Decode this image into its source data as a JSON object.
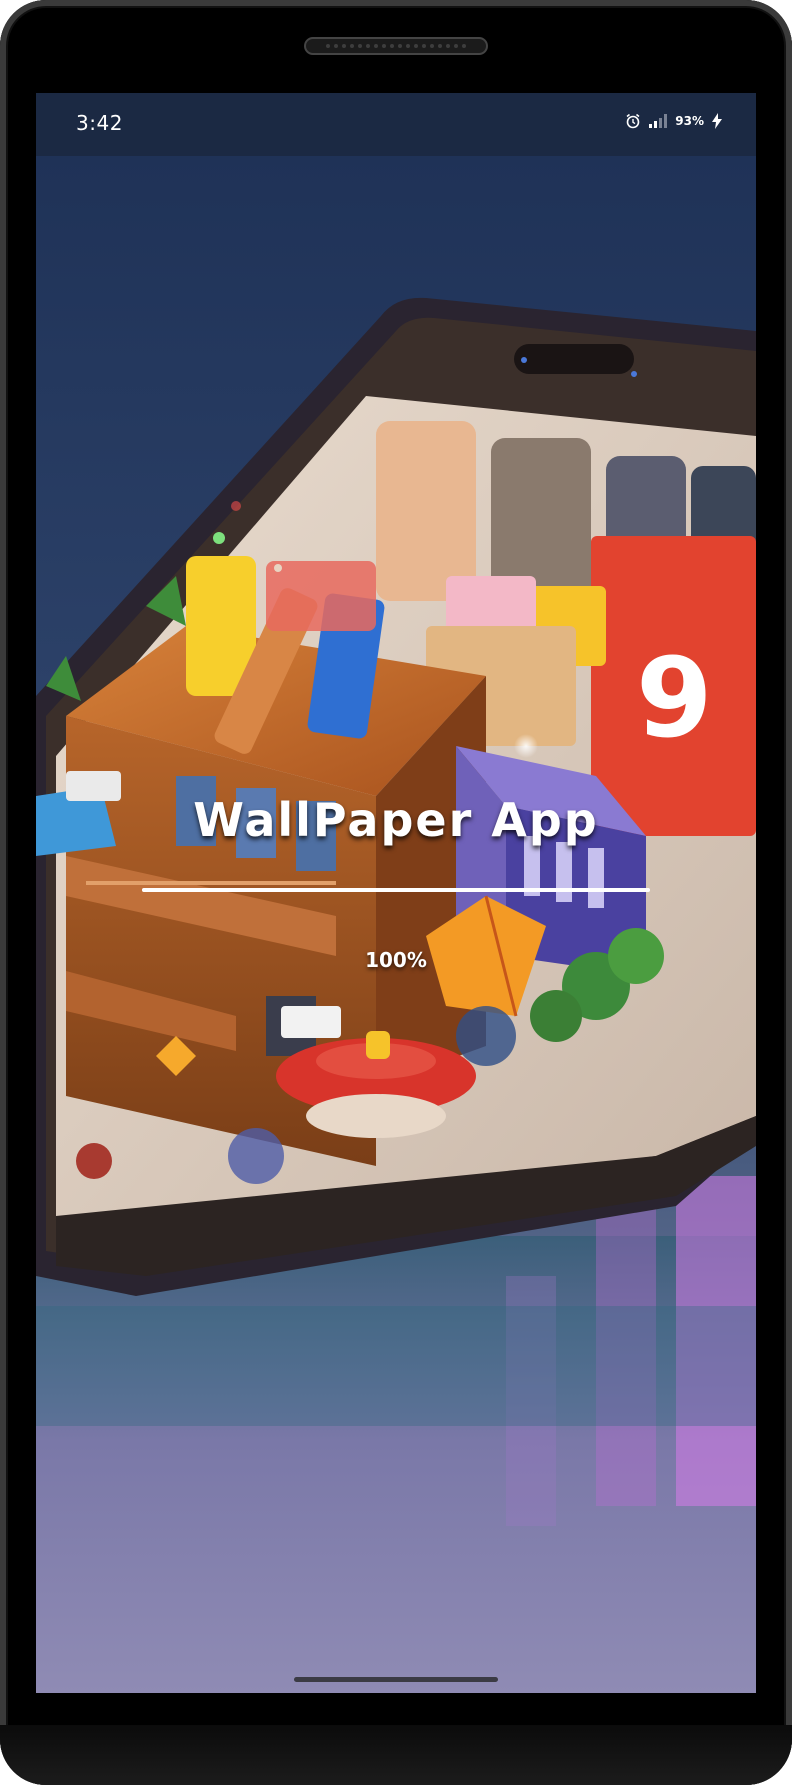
{
  "status_bar": {
    "time": "3:42",
    "battery": "93%",
    "icons": [
      "alarm-icon",
      "signal-icon",
      "charging-bolt-icon"
    ]
  },
  "splash": {
    "title": "WallPaper App",
    "progress_text": "100%",
    "progress_fraction": 1.0
  },
  "background_image": {
    "alt": "isometric illustration of a miniature wooden town emerging from a smartphone screen"
  }
}
